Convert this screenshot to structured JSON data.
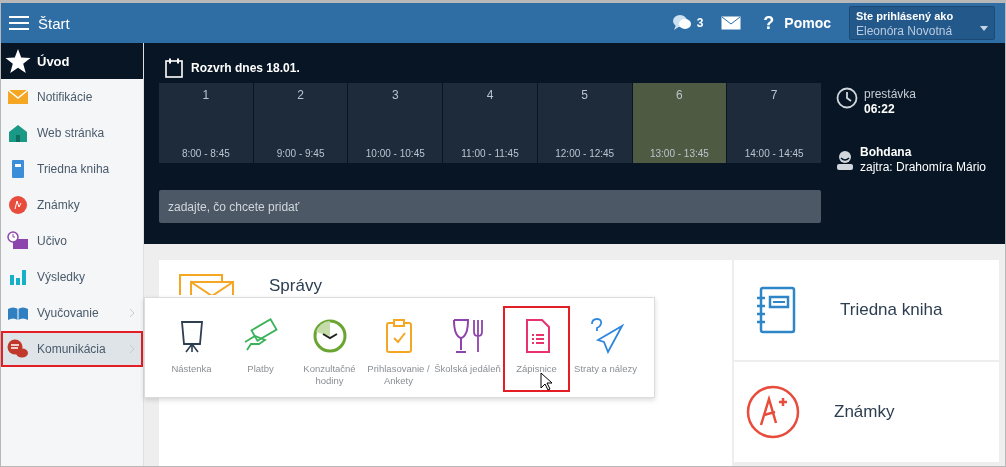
{
  "header": {
    "title": "Štart",
    "messages_count": "3",
    "help_icon": "?",
    "help": "Pomoc",
    "user_label": "Ste prihlásený ako",
    "user_name": "Eleonóra Novotná"
  },
  "sidebar": {
    "home": "Úvod",
    "items": [
      {
        "label": "Notifikácie",
        "selected": false,
        "highlighted": false,
        "submenu": false
      },
      {
        "label": "Web stránka",
        "selected": false,
        "highlighted": false,
        "submenu": false
      },
      {
        "label": "Triedna kniha",
        "selected": false,
        "highlighted": false,
        "submenu": false
      },
      {
        "label": "Známky",
        "selected": false,
        "highlighted": false,
        "submenu": false
      },
      {
        "label": "Učivo",
        "selected": false,
        "highlighted": false,
        "submenu": false
      },
      {
        "label": "Výsledky",
        "selected": false,
        "highlighted": false,
        "submenu": false
      },
      {
        "label": "Vyučovanie",
        "selected": false,
        "highlighted": false,
        "submenu": true
      },
      {
        "label": "Komunikácia",
        "selected": true,
        "highlighted": true,
        "submenu": true
      }
    ]
  },
  "schedule": {
    "title": "Rozvrh dnes 18.01.",
    "periods": [
      {
        "number": "1",
        "time": "8:00 - 8:45",
        "selected": false
      },
      {
        "number": "2",
        "time": "9:00 - 9:45",
        "selected": false
      },
      {
        "number": "3",
        "time": "10:00 - 10:45",
        "selected": false
      },
      {
        "number": "4",
        "time": "11:00 - 11:45",
        "selected": false
      },
      {
        "number": "5",
        "time": "12:00 - 12:45",
        "selected": false
      },
      {
        "number": "6",
        "time": "13:00 - 13:45",
        "selected": true
      },
      {
        "number": "7",
        "time": "14:00 - 14:45",
        "selected": false
      }
    ],
    "add_field": {
      "placeholder": "zadajte, čo chcete pridať"
    }
  },
  "status": {
    "label": "prestávka",
    "time": "06:22",
    "name": "Bohdana",
    "tomorrow": "zajtra: Drahomíra Mário"
  },
  "cards": [
    {
      "label": "Správy"
    },
    {
      "label": "Triedna kniha"
    },
    {
      "label": "Známky"
    }
  ],
  "submenu": {
    "items": [
      {
        "label": "Nástenka",
        "highlighted": false
      },
      {
        "label": "Platby",
        "highlighted": false
      },
      {
        "label": "Konzultačné hodiny",
        "highlighted": false
      },
      {
        "label": "Prihlasovanie / Ankety",
        "highlighted": false
      },
      {
        "label": "Školská jedáleň",
        "highlighted": false
      },
      {
        "label": "Zápisnice",
        "highlighted": true
      },
      {
        "label": "Straty a nálezy",
        "highlighted": false
      }
    ]
  }
}
